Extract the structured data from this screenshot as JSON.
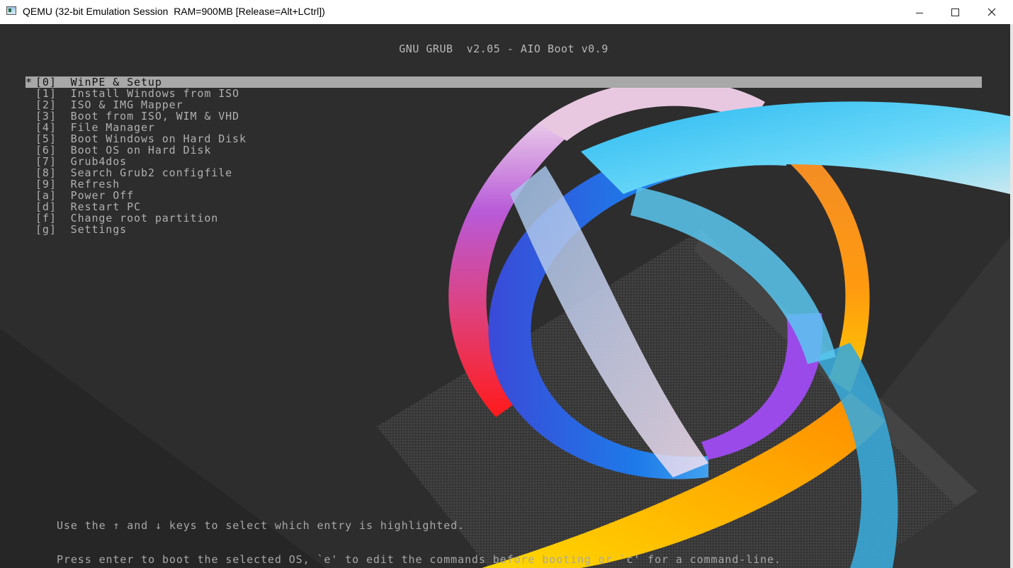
{
  "window": {
    "title": "QEMU (32-bit Emulation Session  RAM=900MB [Release=Alt+LCtrl])",
    "minimize_icon": "minimize-icon",
    "maximize_icon": "maximize-icon",
    "close_icon": "close-icon"
  },
  "grub": {
    "header": "GNU GRUB  v2.05 - AIO Boot v0.9",
    "selected_marker": "*",
    "menu": [
      {
        "label": "[0]  WinPE & Setup",
        "selected": true
      },
      {
        "label": "[1]  Install Windows from ISO",
        "selected": false
      },
      {
        "label": "[2]  ISO & IMG Mapper",
        "selected": false
      },
      {
        "label": "[3]  Boot from ISO, WIM & VHD",
        "selected": false
      },
      {
        "label": "[4]  File Manager",
        "selected": false
      },
      {
        "label": "[5]  Boot Windows on Hard Disk",
        "selected": false
      },
      {
        "label": "[6]  Boot OS on Hard Disk",
        "selected": false
      },
      {
        "label": "[7]  Grub4dos",
        "selected": false
      },
      {
        "label": "[8]  Search Grub2 configfile",
        "selected": false
      },
      {
        "label": "[9]  Refresh",
        "selected": false
      },
      {
        "label": "[a]  Power Off",
        "selected": false
      },
      {
        "label": "[d]  Restart PC",
        "selected": false
      },
      {
        "label": "[f]  Change root partition",
        "selected": false
      },
      {
        "label": "[g]  Settings",
        "selected": false
      }
    ],
    "help_line_1": "Use the ↑ and ↓ keys to select which entry is highlighted.",
    "help_line_2": "Press enter to boot the selected OS, `e' to edit the commands before booting or `c' for a command-line."
  },
  "colors": {
    "screen_bg": "#2b2b2b",
    "menu_text": "#b0b0b0",
    "highlight_bg": "#a8a8a8",
    "highlight_text": "#111111"
  }
}
